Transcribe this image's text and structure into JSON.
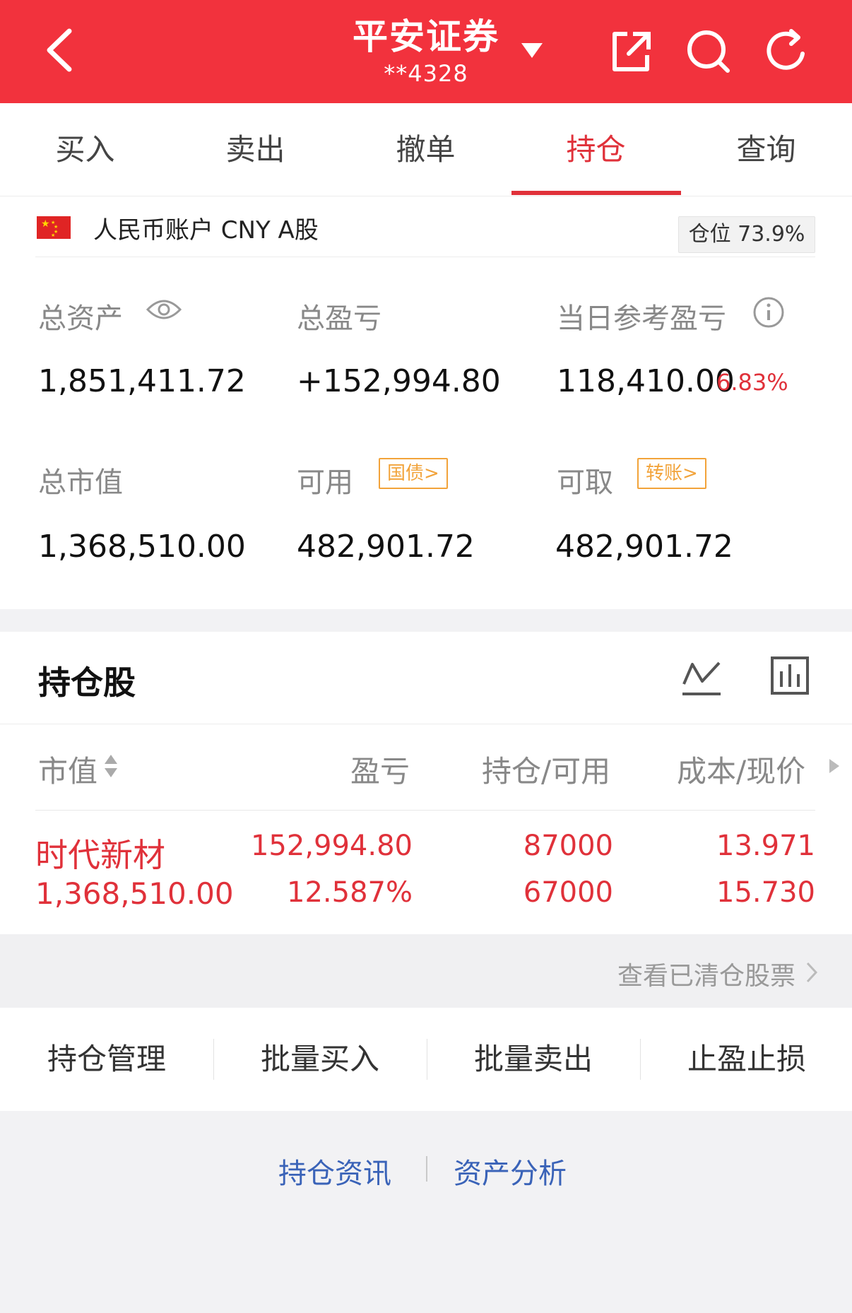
{
  "header": {
    "title": "平安证券",
    "account_mask": "**4328",
    "icons": [
      "back-arrow-icon",
      "dropdown-caret-icon",
      "share-icon",
      "search-icon",
      "refresh-icon"
    ]
  },
  "tabs": [
    {
      "label": "买入",
      "active": false
    },
    {
      "label": "卖出",
      "active": false
    },
    {
      "label": "撤单",
      "active": false
    },
    {
      "label": "持仓",
      "active": true
    },
    {
      "label": "查询",
      "active": false
    }
  ],
  "account": {
    "label": "人民币账户 CNY A股",
    "position_ratio": "仓位 73.9%",
    "total_assets_label": "总资产",
    "total_assets": "1,851,411.72",
    "total_pnl_label": "总盈亏",
    "total_pnl": "+152,994.80",
    "daily_pnl_label": "当日参考盈亏",
    "daily_pnl": "118,410.00",
    "daily_pnl_pct": "6.83%",
    "market_value_label": "总市值",
    "market_value": "1,368,510.00",
    "available_label": "可用",
    "available_tag": "国债>",
    "available": "482,901.72",
    "withdrawable_label": "可取",
    "withdrawable_tag": "转账>",
    "withdrawable": "482,901.72"
  },
  "holdings": {
    "title": "持仓股",
    "columns": {
      "market_value": "市值",
      "pnl": "盈亏",
      "position": "持仓/可用",
      "cost": "成本/现价"
    },
    "rows": [
      {
        "name": "时代新材",
        "market_value": "1,368,510.00",
        "pnl": "152,994.80",
        "pnl_pct": "12.587%",
        "position": "87000",
        "available": "67000",
        "cost": "13.971",
        "price": "15.730"
      }
    ]
  },
  "cleared_link": "查看已清仓股票",
  "actions": [
    "持仓管理",
    "批量买入",
    "批量卖出",
    "止盈止损"
  ],
  "footer_links": [
    "持仓资讯",
    "资产分析"
  ],
  "colors": {
    "header_bg": "#f2323d",
    "accent_red": "#e0313a",
    "tag_orange": "#f2a33a",
    "link_blue": "#3a63b8"
  }
}
